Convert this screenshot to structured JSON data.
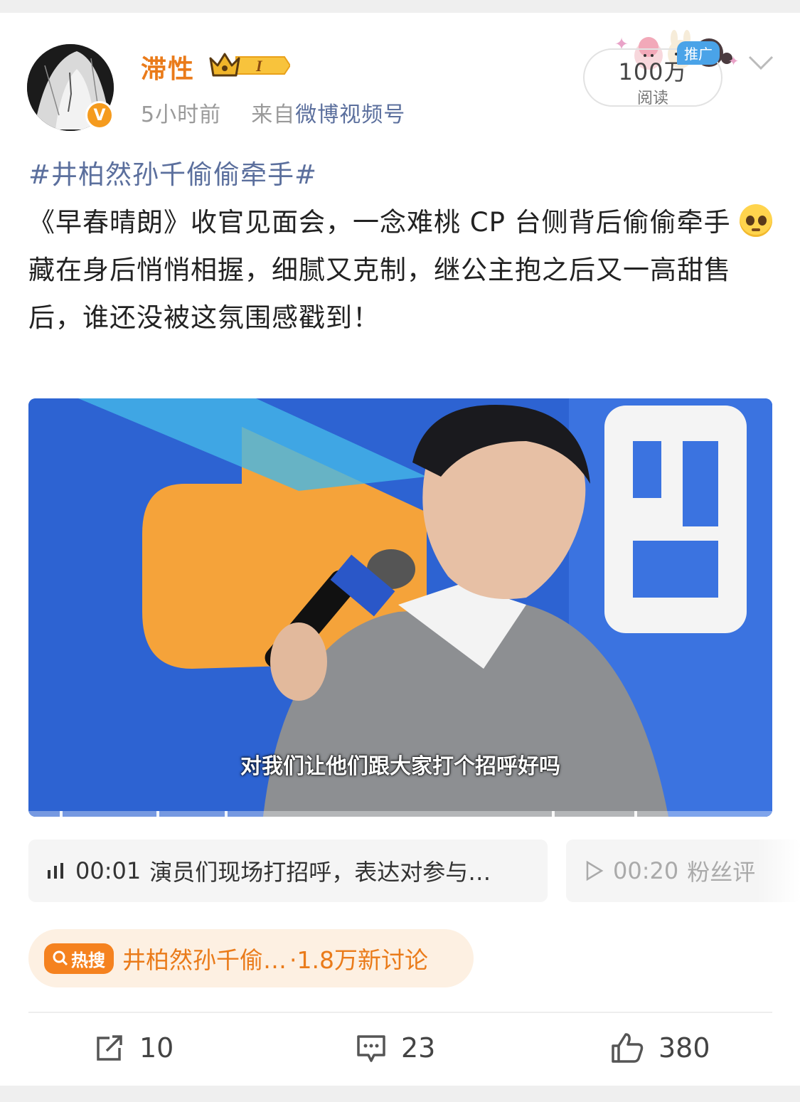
{
  "header": {
    "username": "滞性",
    "badge_letter": "I",
    "verified_mark": "V",
    "time": "5小时前",
    "source_prefix": "来自",
    "source_name": "微博视频号",
    "reads_count": "100万",
    "reads_label": "阅读",
    "promo_label": "推广"
  },
  "post": {
    "topic": "#井柏然孙千偷偷牵手#",
    "line1": "《早春晴朗》收官见面会，一念难桃 CP 台侧背后偷偷牵手",
    "line2": "藏在身后悄悄相握，细腻又克制，继公主抱之后又一高甜售后，谁还没被这氛围感戳到！"
  },
  "video": {
    "subtitle": "对我们让他们跟大家打个招呼好吗"
  },
  "chapters": [
    {
      "time": "00:01",
      "text": "演员们现场打招呼，表达对参与…",
      "icon": "audio-bars-icon"
    },
    {
      "time": "00:20",
      "text": "粉丝评",
      "icon": "play-icon"
    }
  ],
  "hot_search": {
    "badge": "热搜",
    "text": "井柏然孙千偷…",
    "count": "·1.8万新讨论"
  },
  "actions": {
    "repost": "10",
    "comment": "23",
    "like": "380"
  },
  "colors": {
    "username": "#ea7b1a",
    "topic_link": "#5b6f9d",
    "promo": "#4aa3e8",
    "hot_badge": "#f5821f",
    "hot_bg": "#fdf0e2"
  }
}
